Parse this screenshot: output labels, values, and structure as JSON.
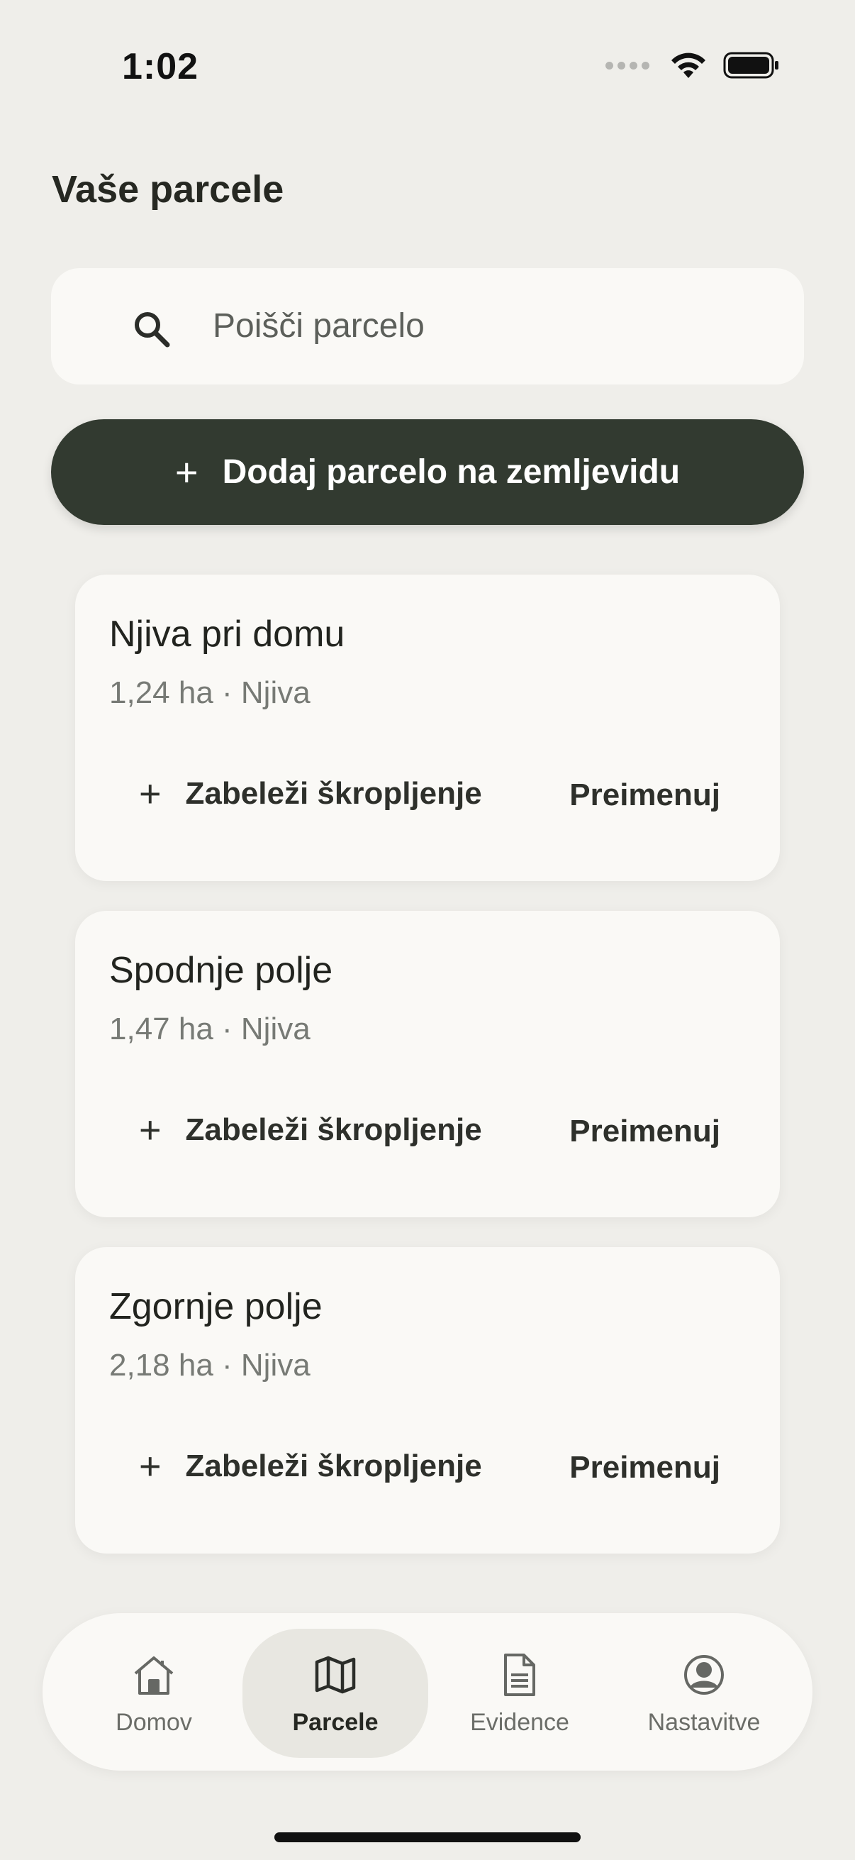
{
  "status": {
    "time": "1:02"
  },
  "page": {
    "title": "Vaše parcele"
  },
  "search": {
    "placeholder": "Poišči parcelo"
  },
  "add_button": {
    "label": "Dodaj parcelo na zemljevidu"
  },
  "parcels": [
    {
      "name": "Njiva pri domu",
      "meta": "1,24 ha · Njiva",
      "spray_label": "Zabeleži škropljenje",
      "rename_label": "Preimenuj"
    },
    {
      "name": "Spodnje polje",
      "meta": "1,47 ha · Njiva",
      "spray_label": "Zabeleži škropljenje",
      "rename_label": "Preimenuj"
    },
    {
      "name": "Zgornje polje",
      "meta": "2,18 ha · Njiva",
      "spray_label": "Zabeleži škropljenje",
      "rename_label": "Preimenuj"
    }
  ],
  "nav": [
    {
      "label": "Domov",
      "icon": "home-icon",
      "active": false
    },
    {
      "label": "Parcele",
      "icon": "map-icon",
      "active": true
    },
    {
      "label": "Evidence",
      "icon": "document-icon",
      "active": false
    },
    {
      "label": "Nastavitve",
      "icon": "user-circle-icon",
      "active": false
    }
  ],
  "colors": {
    "background": "#efeeea",
    "primary": "#323a30",
    "card": "#faf9f6",
    "nav_active": "#e8e7e1"
  }
}
